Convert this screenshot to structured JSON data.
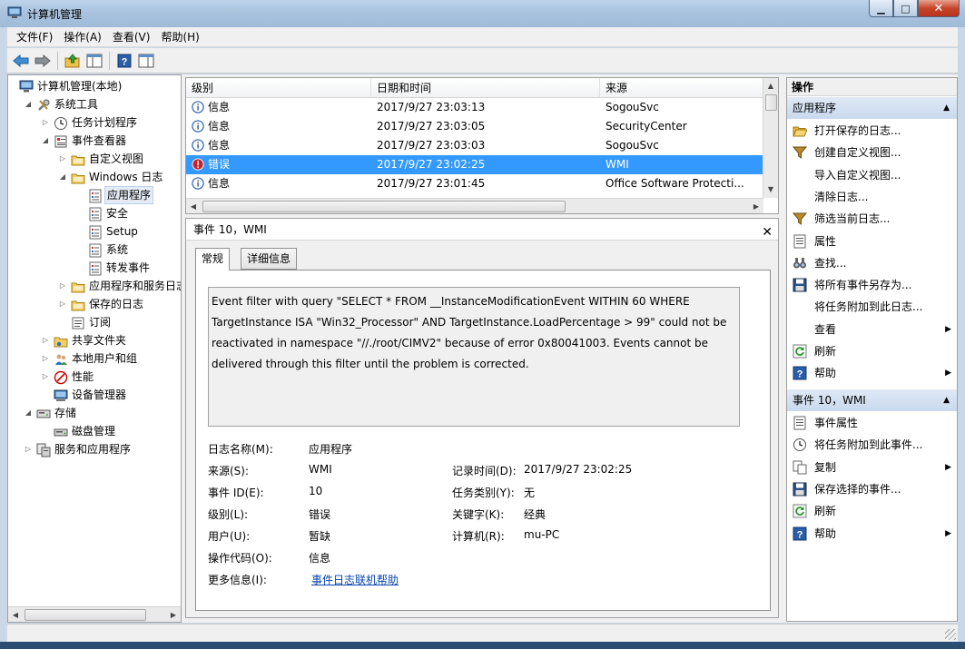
{
  "window": {
    "title": "计算机管理"
  },
  "menu": [
    "文件(F)",
    "操作(A)",
    "查看(V)",
    "帮助(H)"
  ],
  "tree": [
    {
      "label": "计算机管理(本地)",
      "level": 0,
      "exp": "",
      "icon": "computer-icon"
    },
    {
      "label": "系统工具",
      "level": 1,
      "exp": "down",
      "icon": "tools-icon"
    },
    {
      "label": "任务计划程序",
      "level": 2,
      "exp": "right",
      "icon": "clock-icon"
    },
    {
      "label": "事件查看器",
      "level": 2,
      "exp": "down",
      "icon": "event-viewer-icon"
    },
    {
      "label": "自定义视图",
      "level": 3,
      "exp": "right",
      "icon": "folder-icon"
    },
    {
      "label": "Windows 日志",
      "level": 3,
      "exp": "down",
      "icon": "folder-icon"
    },
    {
      "label": "应用程序",
      "level": 4,
      "exp": "",
      "icon": "log-icon",
      "selected": true
    },
    {
      "label": "安全",
      "level": 4,
      "exp": "",
      "icon": "log-icon"
    },
    {
      "label": "Setup",
      "level": 4,
      "exp": "",
      "icon": "log-icon"
    },
    {
      "label": "系统",
      "level": 4,
      "exp": "",
      "icon": "log-icon"
    },
    {
      "label": "转发事件",
      "level": 4,
      "exp": "",
      "icon": "log-icon"
    },
    {
      "label": "应用程序和服务日志",
      "level": 3,
      "exp": "right",
      "icon": "folder-icon"
    },
    {
      "label": "保存的日志",
      "level": 3,
      "exp": "right",
      "icon": "folder-icon"
    },
    {
      "label": "订阅",
      "level": 3,
      "exp": "",
      "icon": "subscription-icon"
    },
    {
      "label": "共享文件夹",
      "level": 2,
      "exp": "right",
      "icon": "shared-folder-icon"
    },
    {
      "label": "本地用户和组",
      "level": 2,
      "exp": "right",
      "icon": "users-icon"
    },
    {
      "label": "性能",
      "level": 2,
      "exp": "right",
      "icon": "performance-icon"
    },
    {
      "label": "设备管理器",
      "level": 2,
      "exp": "",
      "icon": "device-manager-icon"
    },
    {
      "label": "存储",
      "level": 1,
      "exp": "down",
      "icon": "storage-icon"
    },
    {
      "label": "磁盘管理",
      "level": 2,
      "exp": "",
      "icon": "disk-icon"
    },
    {
      "label": "服务和应用程序",
      "level": 1,
      "exp": "right",
      "icon": "services-icon"
    }
  ],
  "list": {
    "headers": [
      "级别",
      "日期和时间",
      "来源"
    ],
    "rows": [
      {
        "level": "信息",
        "date": "2017/9/27 23:03:13",
        "source": "SogouSvc",
        "type": "info"
      },
      {
        "level": "信息",
        "date": "2017/9/27 23:03:05",
        "source": "SecurityCenter",
        "type": "info"
      },
      {
        "level": "信息",
        "date": "2017/9/27 23:03:03",
        "source": "SogouSvc",
        "type": "info"
      },
      {
        "level": "错误",
        "date": "2017/9/27 23:02:25",
        "source": "WMI",
        "type": "error",
        "selected": true
      },
      {
        "level": "信息",
        "date": "2017/9/27 23:01:45",
        "source": "Office Software Protecti...",
        "type": "info"
      }
    ]
  },
  "detail": {
    "title": "事件 10，WMI",
    "tabs": [
      "常规",
      "详细信息"
    ],
    "message": "Event filter with query \"SELECT * FROM __InstanceModificationEvent WITHIN 60 WHERE TargetInstance ISA \"Win32_Processor\" AND TargetInstance.LoadPercentage > 99\" could not be reactivated in namespace \"//./root/CIMV2\" because of error 0x80041003. Events cannot be delivered through this filter until the problem is corrected.",
    "fields": {
      "logname_label": "日志名称(M):",
      "logname": "应用程序",
      "source_label": "来源(S):",
      "source": "WMI",
      "recorded_label": "记录时间(D):",
      "recorded": "2017/9/27 23:02:25",
      "eventid_label": "事件 ID(E):",
      "eventid": "10",
      "category_label": "任务类别(Y):",
      "category": "无",
      "level_label": "级别(L):",
      "level": "错误",
      "keywords_label": "关键字(K):",
      "keywords": "经典",
      "user_label": "用户(U):",
      "user": "暂缺",
      "computer_label": "计算机(R):",
      "computer": "mu-PC",
      "opcode_label": "操作代码(O):",
      "opcode": "信息",
      "moreinfo_label": "更多信息(I):",
      "moreinfo": "事件日志联机帮助"
    }
  },
  "actions": {
    "header": "操作",
    "section1": "应用程序",
    "items1": [
      {
        "label": "打开保存的日志...",
        "icon": "open-folder-icon"
      },
      {
        "label": "创建自定义视图...",
        "icon": "filter-icon"
      },
      {
        "label": "导入自定义视图...",
        "icon": ""
      },
      {
        "label": "清除日志...",
        "icon": ""
      },
      {
        "label": "筛选当前日志...",
        "icon": "filter-icon"
      },
      {
        "label": "属性",
        "icon": "properties-icon"
      },
      {
        "label": "查找...",
        "icon": "binoculars-icon"
      },
      {
        "label": "将所有事件另存为...",
        "icon": "save-icon"
      },
      {
        "label": "将任务附加到此日志...",
        "icon": ""
      },
      {
        "label": "查看",
        "icon": "",
        "submenu": true
      },
      {
        "label": "刷新",
        "icon": "refresh-icon"
      },
      {
        "label": "帮助",
        "icon": "help-icon",
        "submenu": true
      }
    ],
    "section2": "事件 10，WMI",
    "items2": [
      {
        "label": "事件属性",
        "icon": "properties-icon"
      },
      {
        "label": "将任务附加到此事件...",
        "icon": "task-icon"
      },
      {
        "label": "复制",
        "icon": "copy-icon",
        "submenu": true
      },
      {
        "label": "保存选择的事件...",
        "icon": "save-icon"
      },
      {
        "label": "刷新",
        "icon": "refresh-icon"
      },
      {
        "label": "帮助",
        "icon": "help-icon",
        "submenu": true
      }
    ]
  }
}
